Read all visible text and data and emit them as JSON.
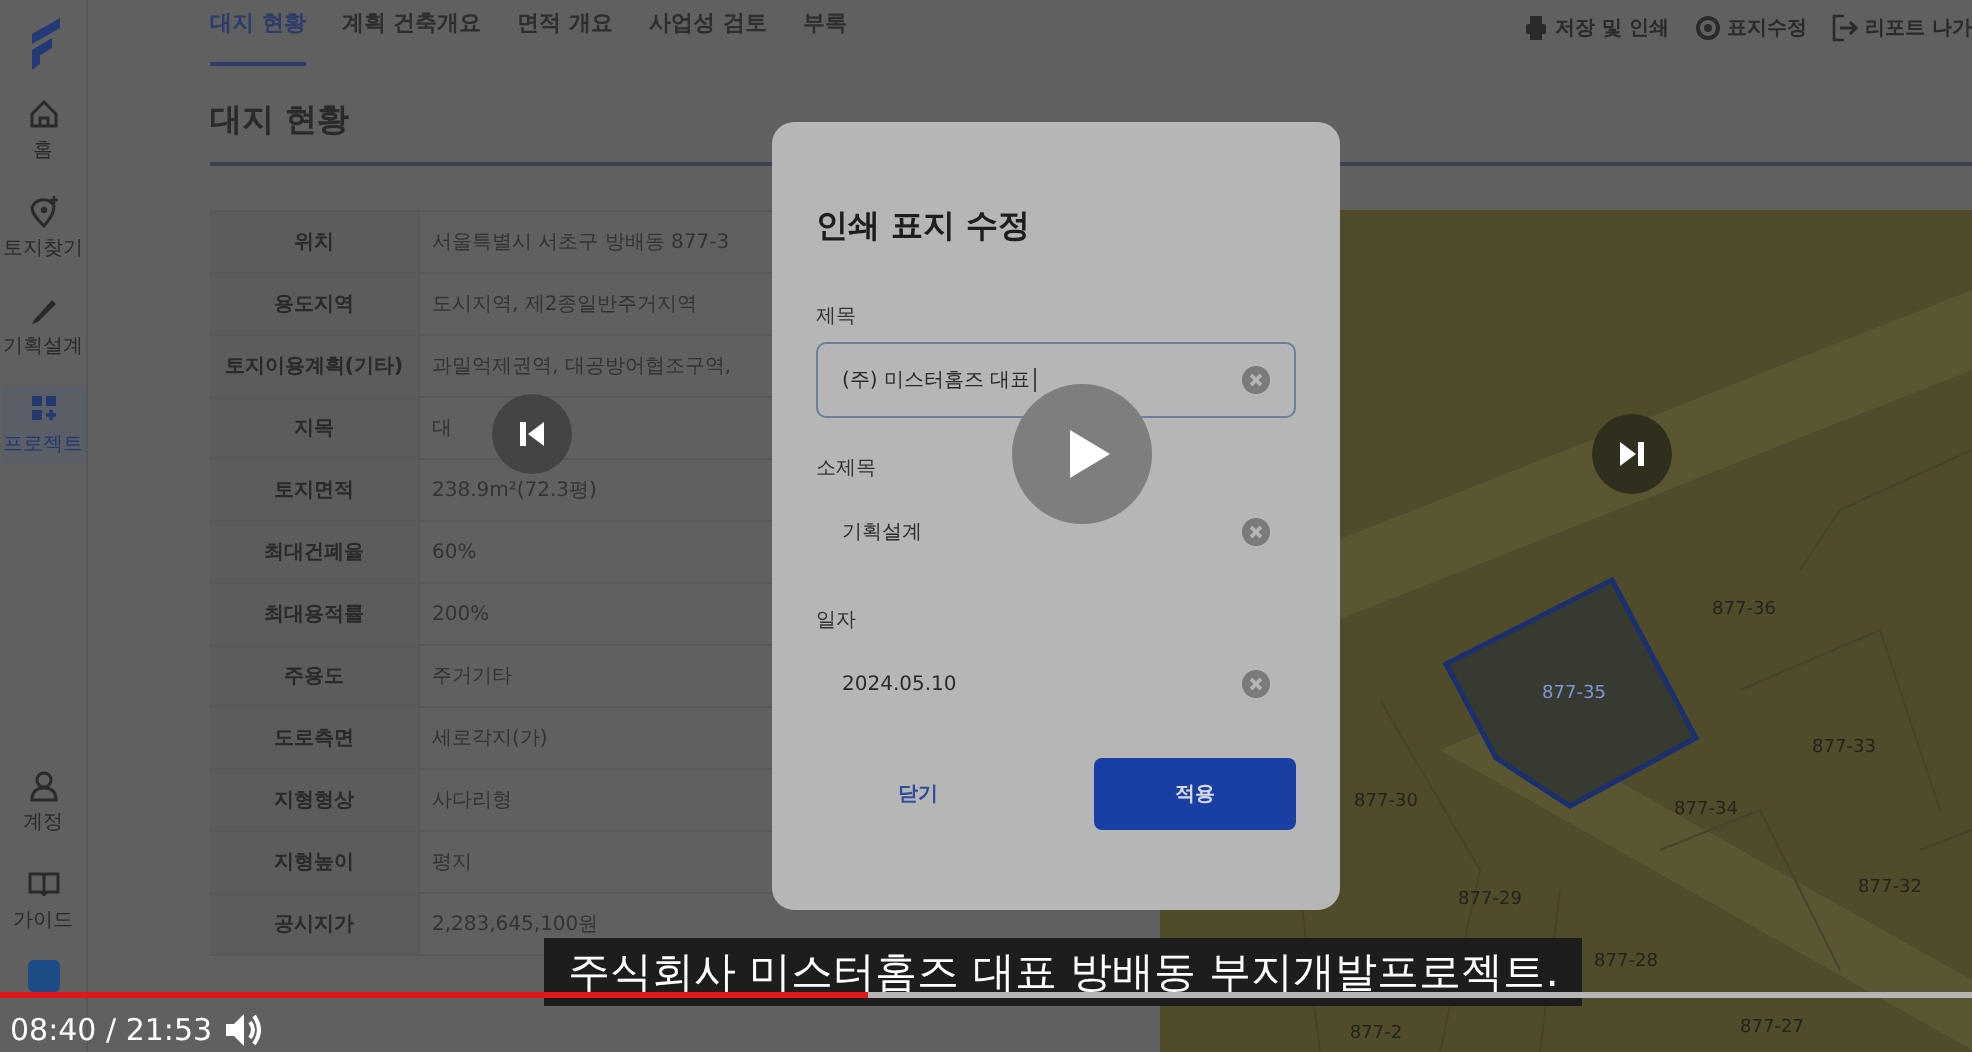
{
  "sidebar": {
    "items": [
      {
        "label": "홈",
        "selected": false
      },
      {
        "label": "토지찾기",
        "selected": false
      },
      {
        "label": "기획설계",
        "selected": false
      },
      {
        "label": "프로젝트",
        "selected": true
      }
    ],
    "bottom_items": [
      {
        "label": "계정"
      },
      {
        "label": "가이드"
      }
    ]
  },
  "tabs": [
    {
      "label": "대지 현황",
      "selected": true
    },
    {
      "label": "계획 건축개요",
      "selected": false
    },
    {
      "label": "면적 개요",
      "selected": false
    },
    {
      "label": "사업성 검토",
      "selected": false
    },
    {
      "label": "부록",
      "selected": false
    }
  ],
  "toolbar": [
    {
      "label": "저장 및 인쇄"
    },
    {
      "label": "표지수정"
    },
    {
      "label": "리포트 나가"
    }
  ],
  "section_title": "대지 현황",
  "site_table": {
    "rows": [
      {
        "label": "위치",
        "value": "서울특별시 서초구 방배동 877-3"
      },
      {
        "label": "용도지역",
        "value": "도시지역, 제2종일반주거지역"
      },
      {
        "label": "토지이용계획(기타)",
        "value": "과밀억제권역, 대공방어협조구역,"
      },
      {
        "label": "지목",
        "value": "대"
      },
      {
        "label": "토지면적",
        "value": "238.9m²(72.3평)"
      },
      {
        "label": "최대건폐율",
        "value": "60%"
      },
      {
        "label": "최대용적률",
        "value": "200%"
      },
      {
        "label": "주용도",
        "value": "주거기타"
      },
      {
        "label": "도로측면",
        "value": "세로각지(가)"
      },
      {
        "label": "지형형상",
        "value": "사다리형"
      },
      {
        "label": "지형높이",
        "value": "평지"
      },
      {
        "label": "공시지가",
        "value": "2,283,645,100원"
      }
    ]
  },
  "map": {
    "parcels": [
      {
        "label": "877-36",
        "selected": false
      },
      {
        "label": "877-35",
        "selected": true
      },
      {
        "label": "877-33",
        "selected": false
      },
      {
        "label": "877-30",
        "selected": false
      },
      {
        "label": "877-34",
        "selected": false
      },
      {
        "label": "877-29",
        "selected": false
      },
      {
        "label": "877-32",
        "selected": false
      },
      {
        "label": "877-28",
        "selected": false
      },
      {
        "label": "877-2",
        "selected": false
      },
      {
        "label": "877-27",
        "selected": false
      }
    ]
  },
  "dialog": {
    "title": "인쇄 표지 수정",
    "fields": [
      {
        "label": "제목",
        "value": "(주) 미스터홈즈 대표",
        "focused": true
      },
      {
        "label": "소제목",
        "value": "기획설계",
        "focused": false
      },
      {
        "label": "일자",
        "value": "2024.05.10",
        "focused": false
      }
    ],
    "buttons": [
      {
        "label": "닫기",
        "kind": "text"
      },
      {
        "label": "적용",
        "kind": "primary"
      }
    ]
  },
  "video_player": {
    "subtitle": "주식회사 미스터홈즈 대표 방배동 부지개발프로젝트.",
    "time": "08:40 / 21:53",
    "progress": {
      "level": 0.44
    }
  }
}
